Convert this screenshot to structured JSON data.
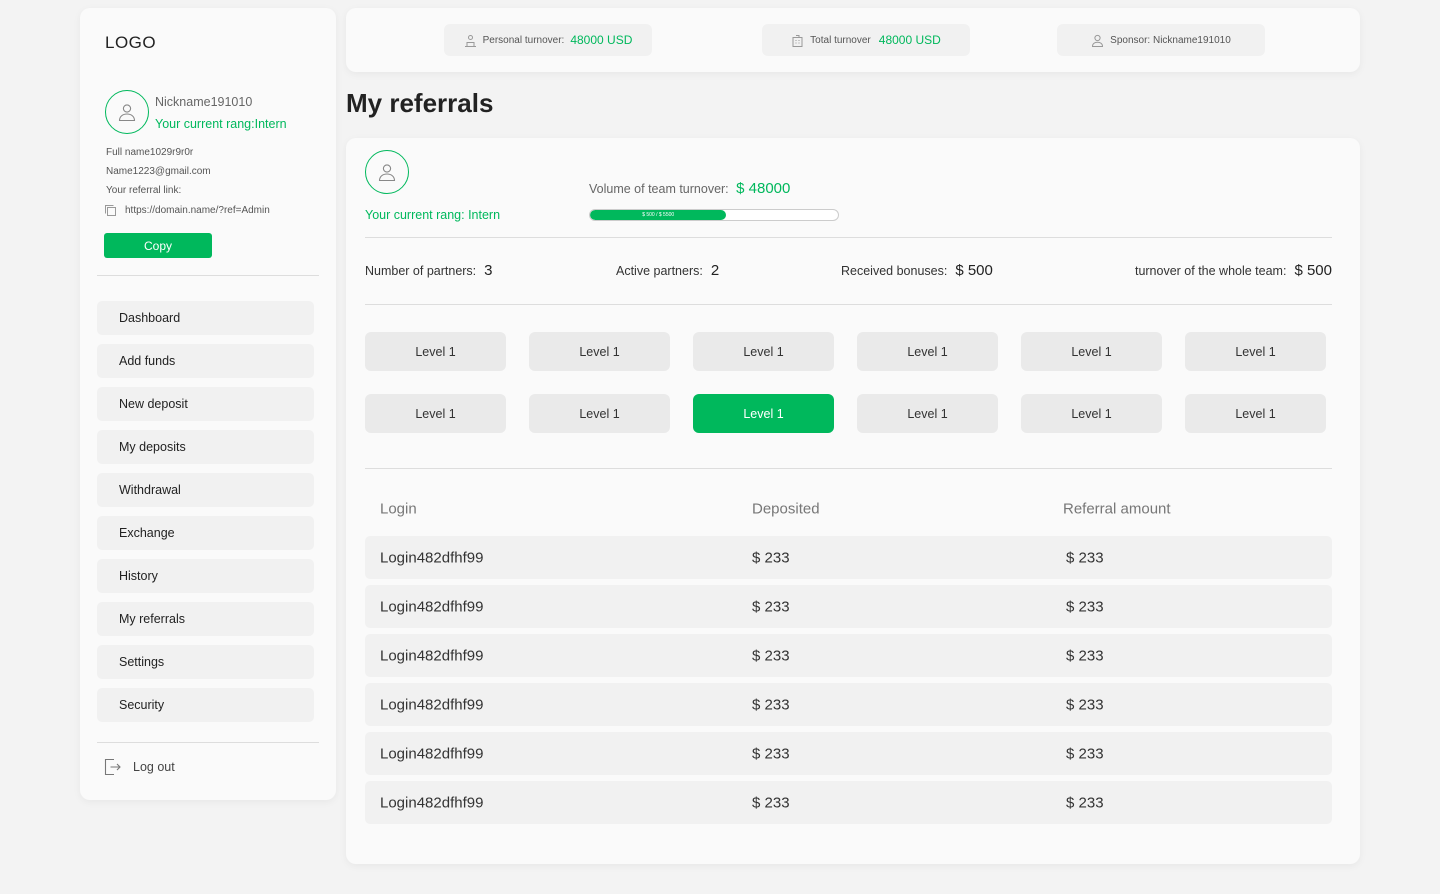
{
  "sidebar": {
    "logo": "LOGO",
    "nickname": "Nickname191010",
    "rang": "Your current rang:Intern",
    "full_name": "Full name1029r9r0r",
    "email": "Name1223@gmail.com",
    "referral_label": "Your referral link:",
    "referral_link": "https://domain.name/?ref=Admin",
    "copy_label": "Copy",
    "nav": [
      "Dashboard",
      "Add funds",
      "New deposit",
      "My deposits",
      "Withdrawal",
      "Exchange",
      "History",
      "My referrals",
      "Settings",
      "Security"
    ],
    "logout_label": "Log out"
  },
  "topbar": {
    "personal_label": "Personal turnover:",
    "personal_value": "48000 USD",
    "total_label": "Total turnover",
    "total_value": "48000 USD",
    "sponsor": "Sponsor: Nickname191010"
  },
  "page": {
    "title": "My referrals",
    "rang": "Your current rang: Intern",
    "volume_label": "Volume of team turnover:",
    "volume_value": "$ 48000",
    "progress_text": "$ 500 / $ 5500",
    "progress_fraction": 0.55
  },
  "stats": {
    "partners_label": "Number of partners:",
    "partners_value": "3",
    "active_label": "Active partners:",
    "active_value": "2",
    "bonuses_label": "Received bonuses:",
    "bonuses_value": "$ 500",
    "team_label": "turnover of the whole team:",
    "team_value": "$ 500"
  },
  "levels": [
    "Level 1",
    "Level 1",
    "Level 1",
    "Level 1",
    "Level 1",
    "Level 1",
    "Level 1",
    "Level 1",
    "Level 1",
    "Level 1",
    "Level 1",
    "Level 1"
  ],
  "accent_color": "#00b85c",
  "table": {
    "headers": [
      "Login",
      "Deposited",
      "Referral amount"
    ],
    "rows": [
      [
        "Login482dfhf99",
        "$ 233",
        "$ 233"
      ],
      [
        "Login482dfhf99",
        "$ 233",
        "$ 233"
      ],
      [
        "Login482dfhf99",
        "$ 233",
        "$ 233"
      ],
      [
        "Login482dfhf99",
        "$ 233",
        "$ 233"
      ],
      [
        "Login482dfhf99",
        "$ 233",
        "$ 233"
      ],
      [
        "Login482dfhf99",
        "$ 233",
        "$ 233"
      ]
    ]
  }
}
